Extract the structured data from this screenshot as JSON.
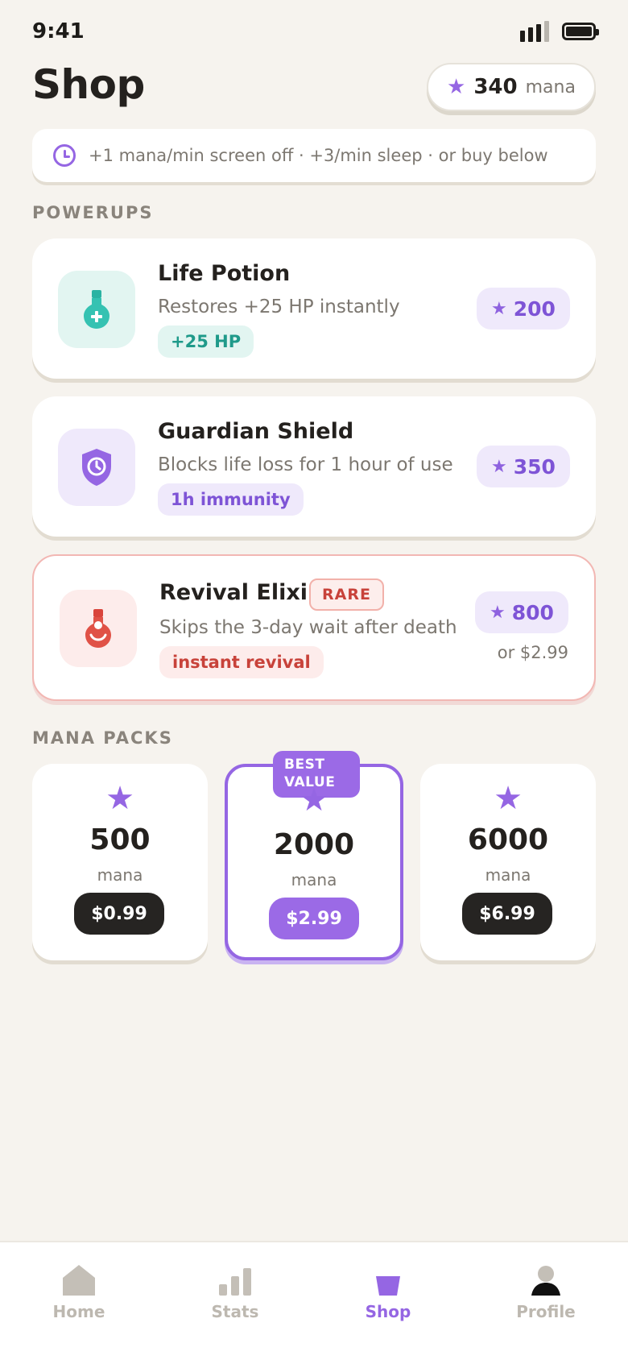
{
  "status": {
    "time": "9:41"
  },
  "header": {
    "title": "Shop",
    "mana_amount": "340",
    "mana_unit": "mana",
    "star": "★"
  },
  "info": {
    "text": "+1 mana/min screen off · +3/min sleep · or buy below"
  },
  "sections": {
    "powerups": "POWERUPS",
    "mana_packs": "MANA PACKS"
  },
  "powerups": [
    {
      "title": "Life Potion",
      "desc": "Restores +25 HP instantly",
      "tag": "+25 HP",
      "price": "200",
      "icon": "potion-icon",
      "accent": "#2bb3a3"
    },
    {
      "title": "Guardian Shield",
      "desc": "Blocks life loss for 1 hour of use",
      "tag": "1h immunity",
      "price": "350",
      "icon": "shield-icon",
      "accent": "#9566e3"
    },
    {
      "title": "Revival Elixir",
      "badge": "RARE",
      "desc": "Skips the 3-day wait after death",
      "tag": "instant revival",
      "price": "800",
      "alt_price": "or $2.99",
      "icon": "elixir-icon",
      "accent": "#d9443b"
    }
  ],
  "packs": [
    {
      "amount": "500",
      "unit": "mana",
      "price": "$0.99"
    },
    {
      "amount": "2000",
      "unit": "mana",
      "price": "$2.99",
      "ribbon_line1": "BEST",
      "ribbon_line2": "VALUE"
    },
    {
      "amount": "6000",
      "unit": "mana",
      "price": "$6.99"
    }
  ],
  "tabs": [
    {
      "label": "Home",
      "icon": "home-icon"
    },
    {
      "label": "Stats",
      "icon": "stats-icon"
    },
    {
      "label": "Shop",
      "icon": "shop-icon",
      "active": true
    },
    {
      "label": "Profile",
      "icon": "profile-icon"
    }
  ],
  "colors": {
    "accent": "#9566e3",
    "background": "#f6f3ee",
    "danger": "#d9443b",
    "teal": "#2bb3a3"
  }
}
